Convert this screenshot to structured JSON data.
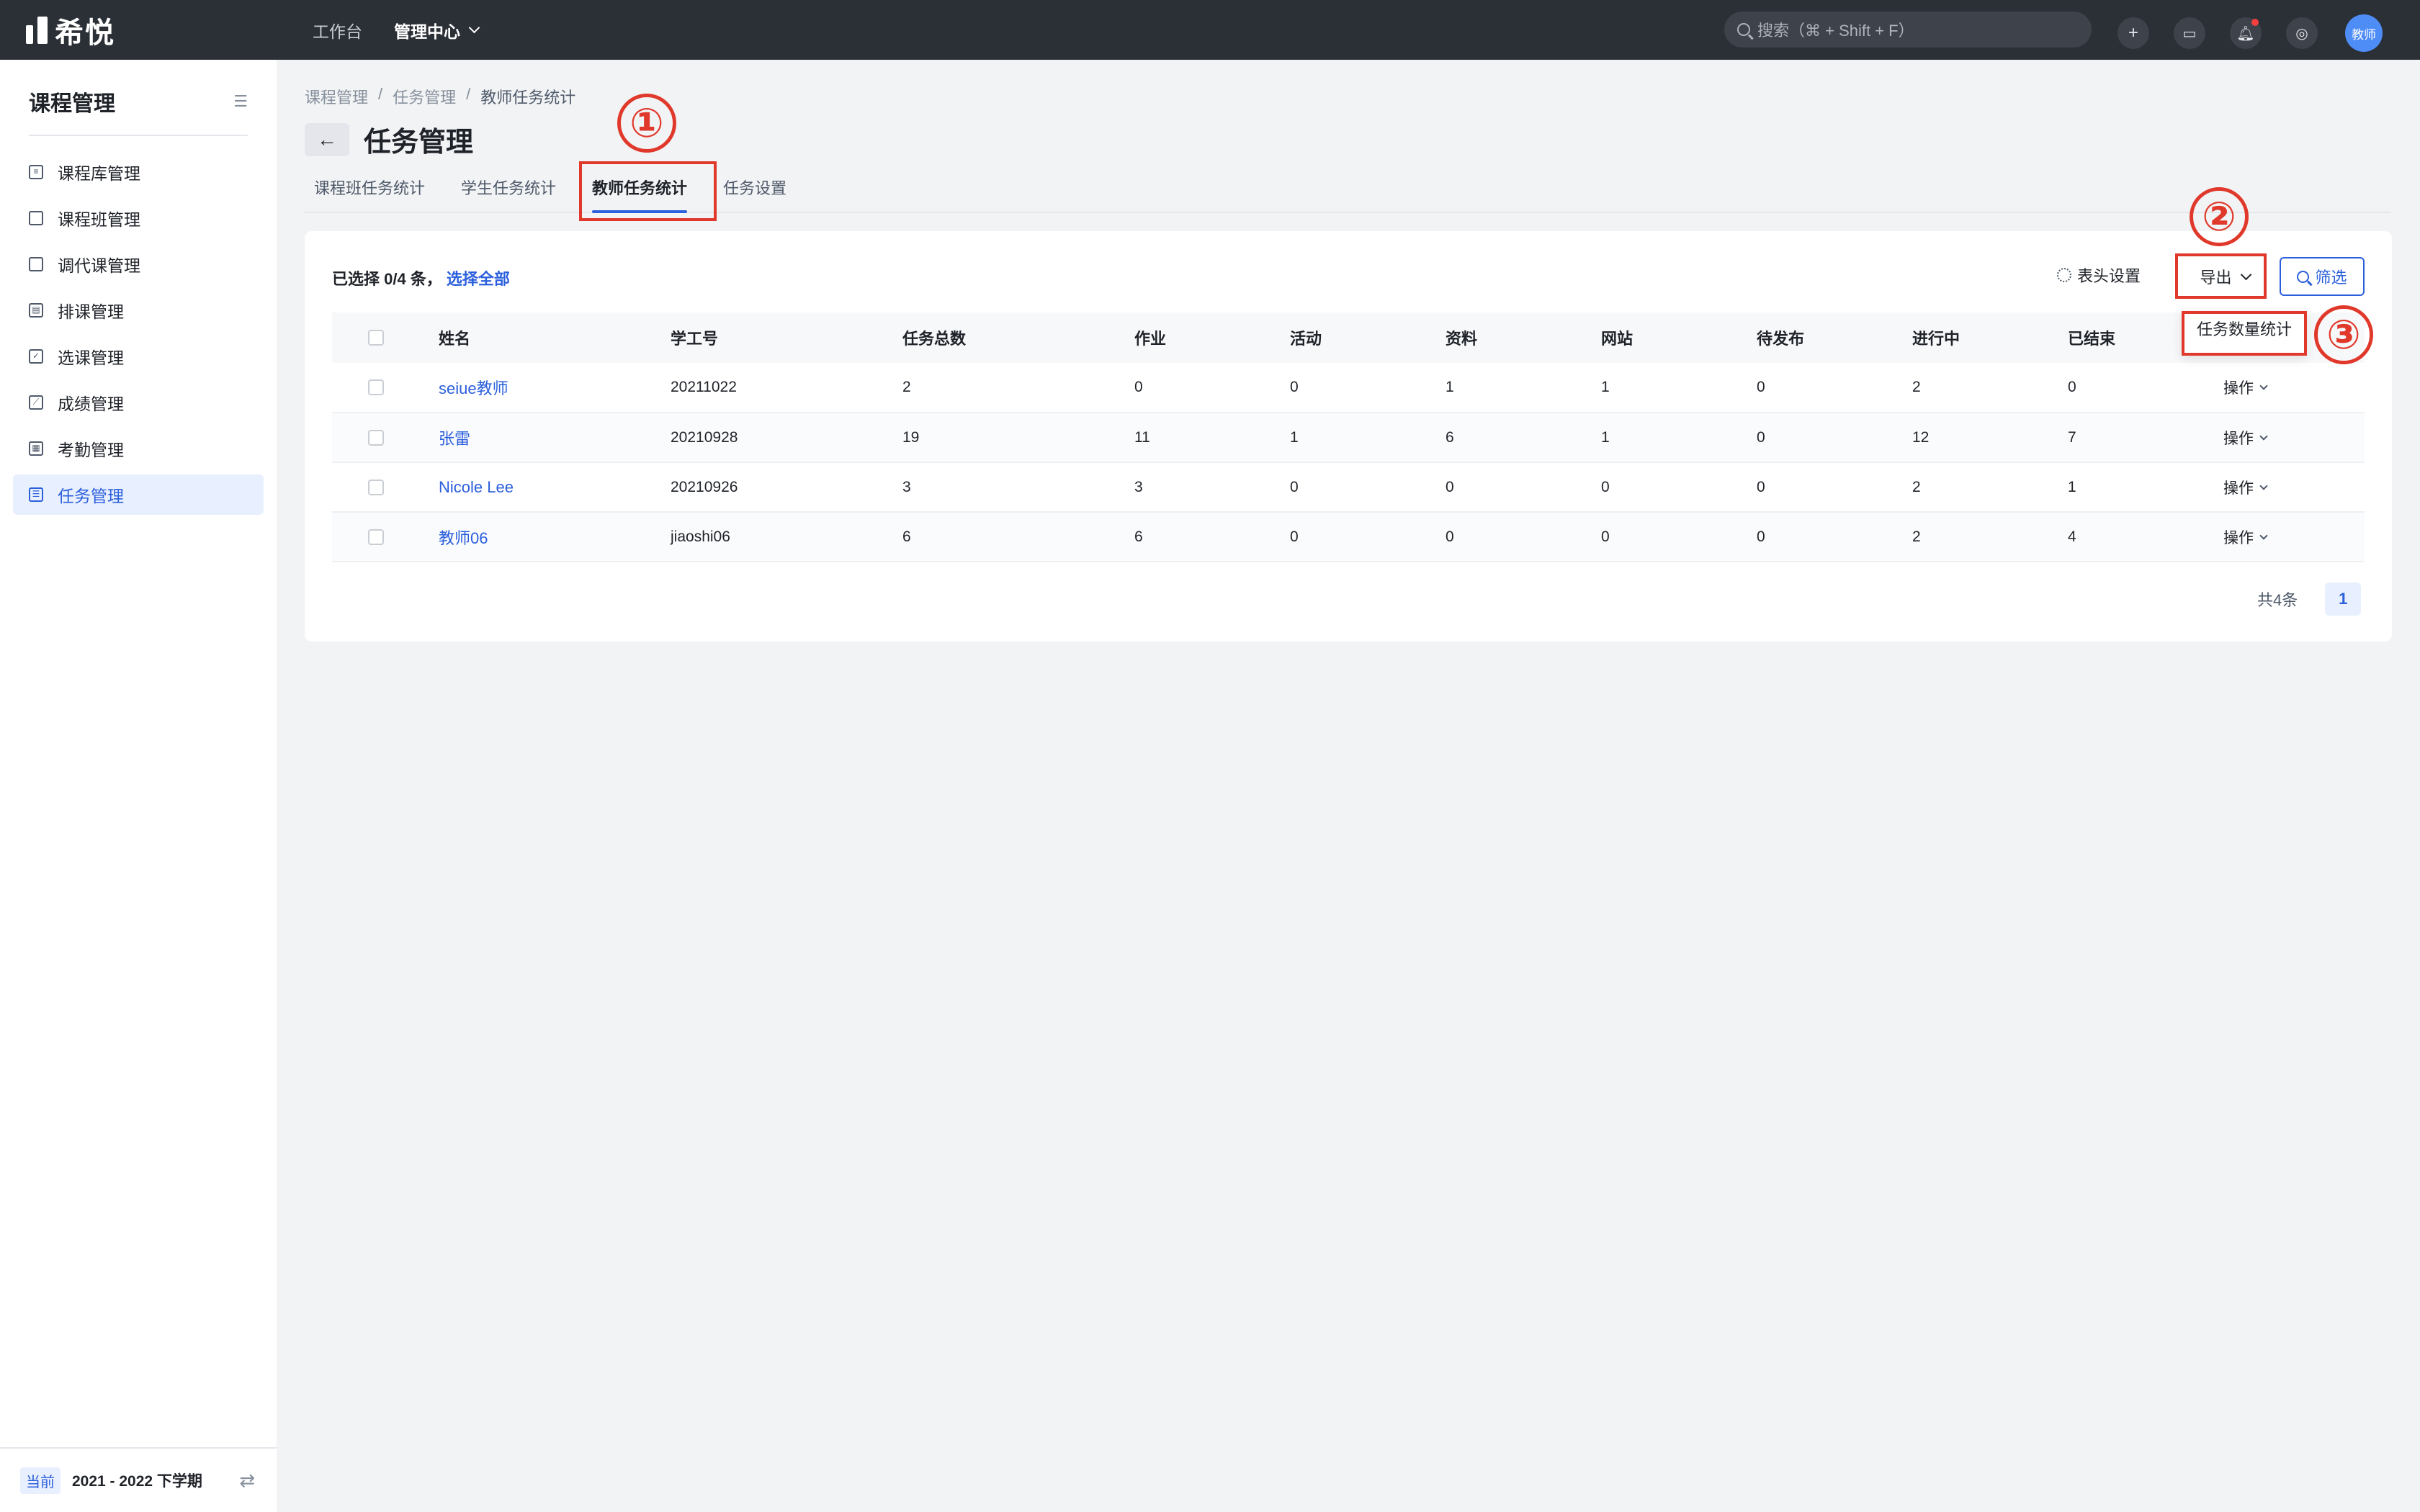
{
  "app": {
    "logo_text": "希悦"
  },
  "topnav": {
    "items": [
      "工作台"
    ],
    "active": "管理中心"
  },
  "search": {
    "placeholder": "搜索（⌘ + Shift + F）"
  },
  "user": {
    "avatar_text": "教师"
  },
  "sidebar": {
    "title": "课程管理",
    "items": [
      {
        "label": "课程库管理",
        "active": false
      },
      {
        "label": "课程班管理",
        "active": false
      },
      {
        "label": "调代课管理",
        "active": false
      },
      {
        "label": "排课管理",
        "active": false
      },
      {
        "label": "选课管理",
        "active": false
      },
      {
        "label": "成绩管理",
        "active": false
      },
      {
        "label": "考勤管理",
        "active": false
      },
      {
        "label": "任务管理",
        "active": true
      }
    ],
    "footer": {
      "badge": "当前",
      "term": "2021 - 2022 下学期"
    }
  },
  "breadcrumb": [
    "课程管理",
    "任务管理",
    "教师任务统计"
  ],
  "page": {
    "title": "任务管理"
  },
  "tabs": [
    {
      "label": "课程班任务统计",
      "active": false
    },
    {
      "label": "学生任务统计",
      "active": false
    },
    {
      "label": "教师任务统计",
      "active": true
    },
    {
      "label": "任务设置",
      "active": false
    }
  ],
  "toolbar": {
    "selection_prefix": "已选择 0/4 条，",
    "select_all": "选择全部",
    "header_settings": "表头设置",
    "export": "导出",
    "filter": "筛选",
    "export_menu_item": "任务数量统计"
  },
  "table": {
    "columns": [
      "姓名",
      "学工号",
      "任务总数",
      "作业",
      "活动",
      "资料",
      "网站",
      "待发布",
      "进行中",
      "已结束"
    ],
    "action_label": "操作",
    "rows": [
      [
        "seiue教师",
        "20211022",
        "2",
        "0",
        "0",
        "1",
        "1",
        "0",
        "2",
        "0"
      ],
      [
        "张雷",
        "20210928",
        "19",
        "11",
        "1",
        "6",
        "1",
        "0",
        "12",
        "7"
      ],
      [
        "Nicole Lee",
        "20210926",
        "3",
        "3",
        "0",
        "0",
        "0",
        "0",
        "2",
        "1"
      ],
      [
        "教师06",
        "jiaoshi06",
        "6",
        "6",
        "0",
        "0",
        "0",
        "0",
        "2",
        "4"
      ]
    ]
  },
  "pagination": {
    "total": "共4条",
    "current": "1"
  },
  "annotations": {
    "n1": "①",
    "n2": "②",
    "n3": "③",
    "color": "#e0392b"
  },
  "colors": {
    "accent": "#2b5fdc",
    "topbar": "#2b2f36"
  }
}
